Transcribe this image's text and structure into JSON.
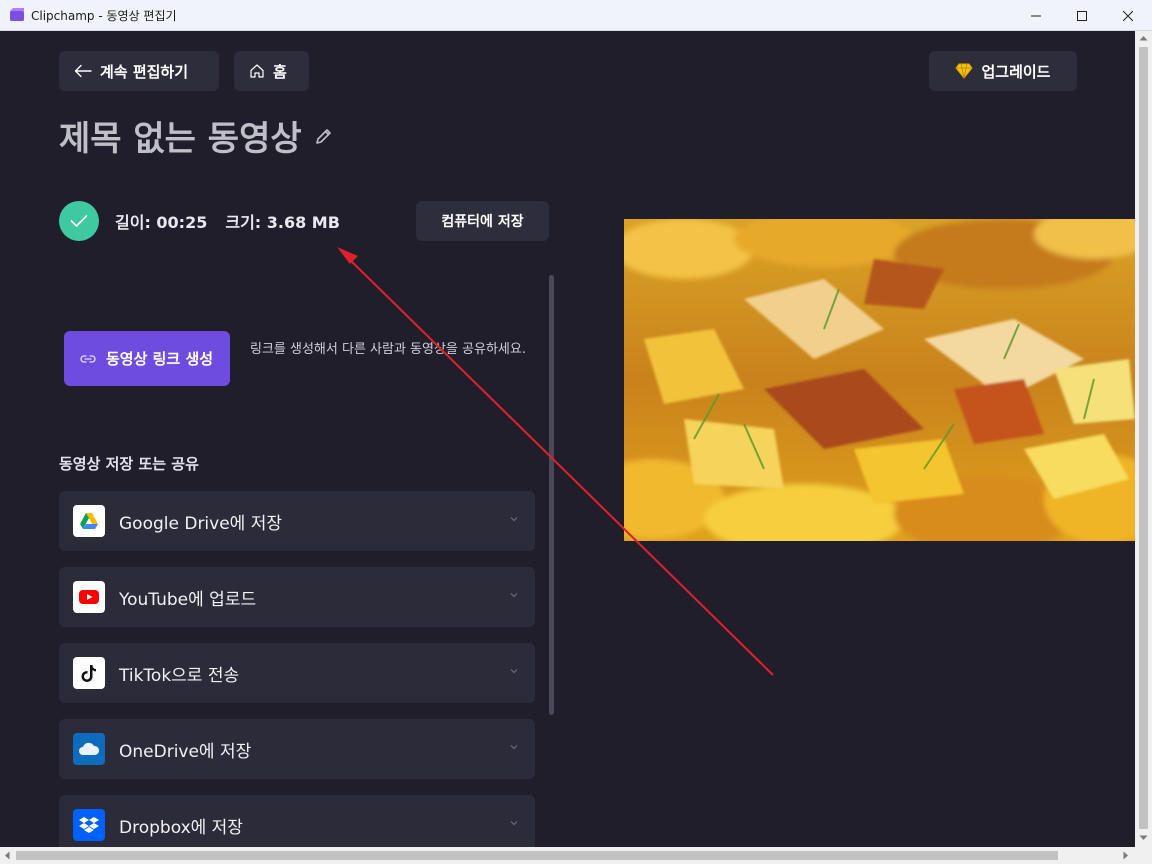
{
  "window": {
    "title": "Clipchamp - 동영상 편집기"
  },
  "header": {
    "back_label": "계속 편집하기",
    "home_label": "홈",
    "upgrade_label": "업그레이드"
  },
  "video": {
    "title": "제목 없는 동영상",
    "length": "길이: 00:25",
    "size": "크기: 3.68 MB",
    "save_to_pc_label": "컴퓨터에 저장"
  },
  "link": {
    "button_label": "동영상 링크 생성",
    "description": "링크를 생성해서 다른 사람과 동영상을 공유하세요."
  },
  "share": {
    "section_title": "동영상 저장 또는 공유",
    "items": [
      {
        "label": "Google Drive에 저장",
        "icon": "google-drive-icon"
      },
      {
        "label": "YouTube에 업로드",
        "icon": "youtube-icon"
      },
      {
        "label": "TikTok으로 전송",
        "icon": "tiktok-icon"
      },
      {
        "label": "OneDrive에 저장",
        "icon": "onedrive-icon"
      },
      {
        "label": "Dropbox에 저장",
        "icon": "dropbox-icon"
      }
    ]
  },
  "colors": {
    "background": "#1f1e2a",
    "accent_purple": "#6f4ce0",
    "success_green": "#3ec9a0",
    "annotation_red": "#e0202a"
  }
}
